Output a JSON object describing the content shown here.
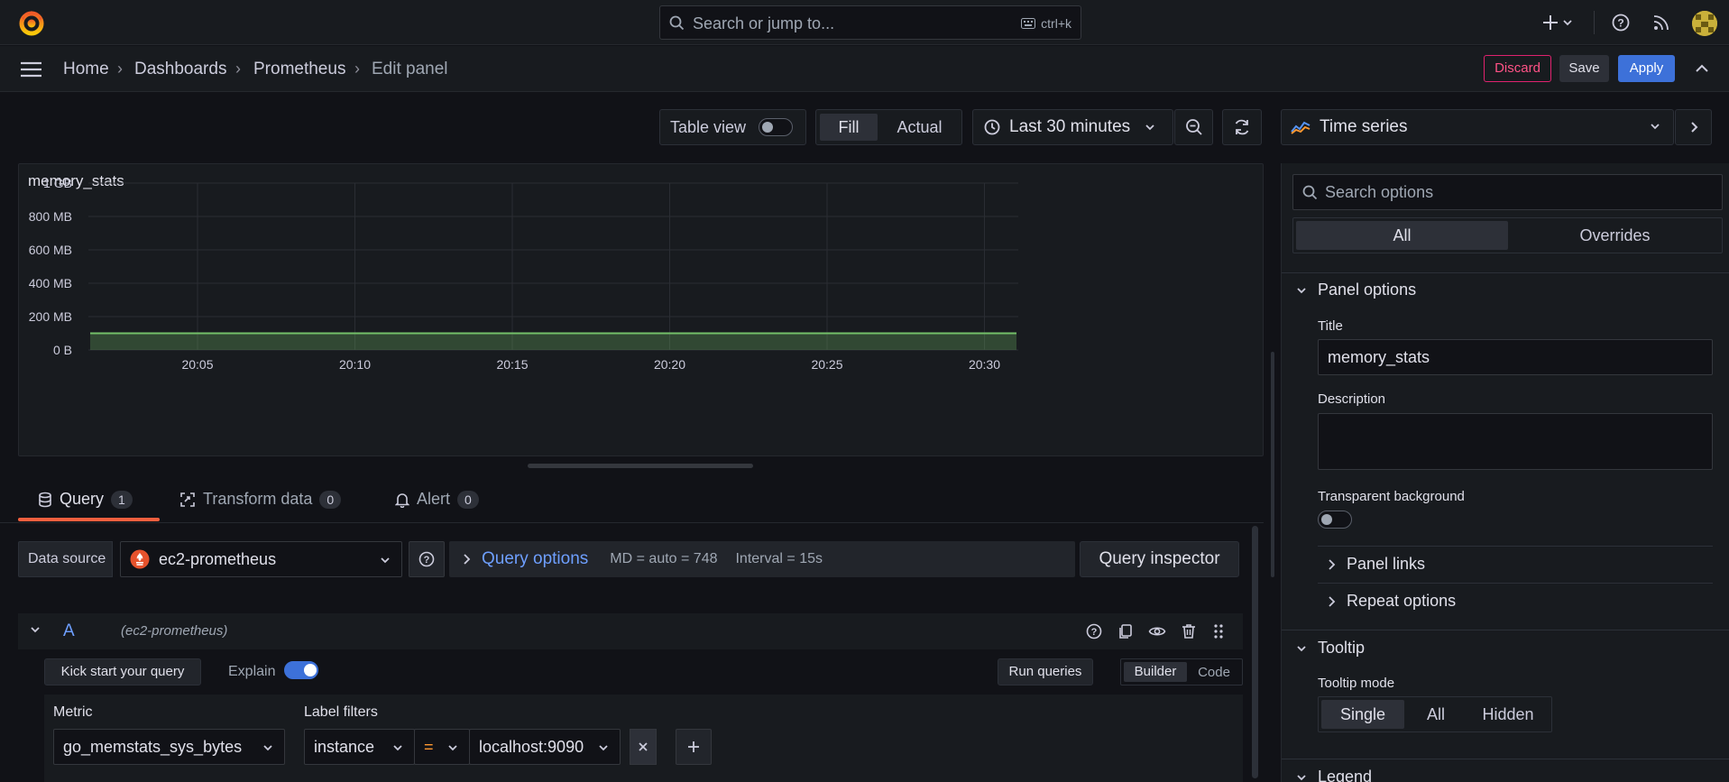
{
  "search": {
    "placeholder": "Search or jump to...",
    "shortcut": "ctrl+k"
  },
  "breadcrumb": [
    "Home",
    "Dashboards",
    "Prometheus",
    "Edit panel"
  ],
  "actions": {
    "discard": "Discard",
    "save": "Save",
    "apply": "Apply"
  },
  "toolbar": {
    "table_view": "Table view",
    "fill": "Fill",
    "actual": "Actual",
    "time_range": "Last 30 minutes",
    "visualization": "Time series"
  },
  "panel": {
    "title": "memory_stats"
  },
  "chart_data": {
    "type": "area",
    "title": "memory_stats",
    "x": [
      "20:05",
      "20:10",
      "20:15",
      "20:20",
      "20:25",
      "20:30"
    ],
    "yticks": [
      "1 GB",
      "800 MB",
      "600 MB",
      "400 MB",
      "200 MB",
      "0 B"
    ],
    "ylim": [
      0,
      1000
    ],
    "grid": true,
    "series": [
      {
        "values": [
          100,
          100,
          100,
          100,
          100,
          100,
          100
        ],
        "color": "#73bf69"
      }
    ]
  },
  "tabs": [
    {
      "label": "Query",
      "count": "1"
    },
    {
      "label": "Transform data",
      "count": "0"
    },
    {
      "label": "Alert",
      "count": "0"
    }
  ],
  "query": {
    "datasource_label": "Data source",
    "datasource": "ec2-prometheus",
    "options_label": "Query options",
    "md": "MD = auto = 748",
    "interval": "Interval = 15s",
    "inspector": "Query inspector",
    "ref": "A",
    "ref_ds": "(ec2-prometheus)",
    "kick_start": "Kick start your query",
    "explain": "Explain",
    "run": "Run queries",
    "builder": "Builder",
    "code": "Code",
    "metric_label": "Metric",
    "metric": "go_memstats_sys_bytes",
    "label_filters": "Label filters",
    "filter_key": "instance",
    "filter_op": "=",
    "filter_value": "localhost:9090"
  },
  "options": {
    "search_placeholder": "Search options",
    "tab_all": "All",
    "tab_overrides": "Overrides",
    "panel_options": "Panel options",
    "title_label": "Title",
    "title_value": "memory_stats",
    "description_label": "Description",
    "transparent_label": "Transparent background",
    "panel_links": "Panel links",
    "repeat_options": "Repeat options",
    "tooltip": "Tooltip",
    "tooltip_mode": "Tooltip mode",
    "tooltip_modes": [
      "Single",
      "All",
      "Hidden"
    ],
    "legend": "Legend"
  }
}
